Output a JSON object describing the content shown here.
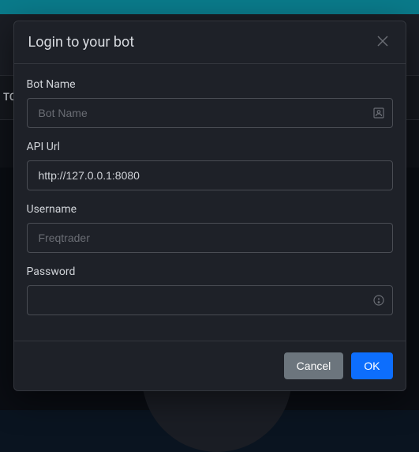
{
  "background": {
    "bar_text": "TC"
  },
  "modal": {
    "title": "Login to your bot",
    "fields": {
      "bot_name": {
        "label": "Bot Name",
        "placeholder": "Bot Name",
        "value": ""
      },
      "api_url": {
        "label": "API Url",
        "placeholder": "",
        "value": "http://127.0.0.1:8080"
      },
      "username": {
        "label": "Username",
        "placeholder": "Freqtrader",
        "value": ""
      },
      "password": {
        "label": "Password",
        "placeholder": "",
        "value": ""
      }
    },
    "buttons": {
      "cancel": "Cancel",
      "ok": "OK"
    }
  }
}
